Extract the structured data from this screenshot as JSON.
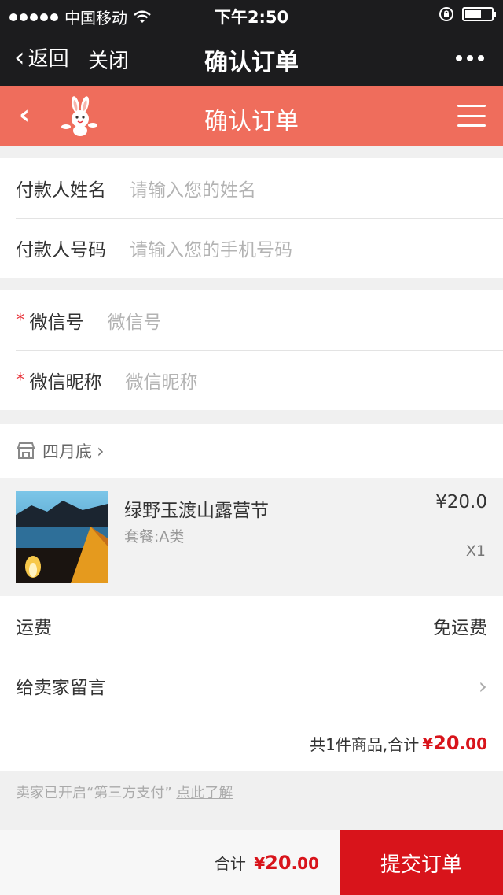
{
  "status": {
    "carrier": "中国移动",
    "time": "下午2:50"
  },
  "wechat_nav": {
    "back": "返回",
    "close": "关闭",
    "title": "确认订单"
  },
  "header": {
    "title": "确认订单"
  },
  "payer": {
    "name_label": "付款人姓名",
    "name_placeholder": "请输入您的姓名",
    "phone_label": "付款人号码",
    "phone_placeholder": "请输入您的手机号码"
  },
  "wechat_info": {
    "required_mark": "*",
    "id_label": "微信号",
    "id_placeholder": "微信号",
    "nick_label": "微信昵称",
    "nick_placeholder": "微信昵称"
  },
  "shop": {
    "name": "四月底"
  },
  "item": {
    "name": "绿野玉渡山露营节",
    "sku": "套餐:A类",
    "price": "¥20.0",
    "qty": "X1"
  },
  "shipping": {
    "label": "运费",
    "value": "免运费"
  },
  "message": {
    "label": "给卖家留言"
  },
  "total": {
    "text": "共1件商品,合计",
    "currency": "¥",
    "int": "20",
    "dec": ".00"
  },
  "pay_note": {
    "text": "卖家已开启“第三方支付”",
    "link": "点此了解"
  },
  "bottom": {
    "label": "合计",
    "currency": "¥",
    "int": "20",
    "dec": ".00",
    "submit": "提交订单"
  },
  "colors": {
    "header": "#ef6d5c",
    "accent_red": "#d8141b"
  }
}
